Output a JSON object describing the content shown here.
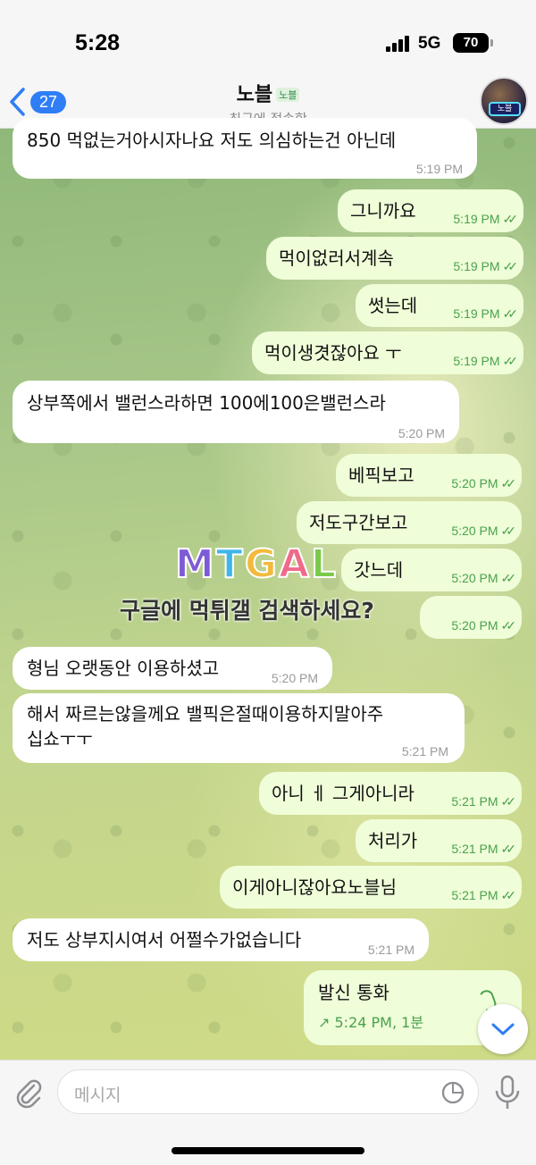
{
  "status_bar": {
    "time": "5:28",
    "network": "5G",
    "battery": "70"
  },
  "header": {
    "back_count": "27",
    "title": "노블",
    "title_badge": "노블",
    "subtitle": "최근에 접속함",
    "avatar_label": "노블"
  },
  "messages": [
    {
      "dir": "in",
      "text": "850 먹없는거아시자나요 저도 의심하는건 아닌데",
      "time": "5:19 PM"
    },
    {
      "dir": "out",
      "text": "그니까요",
      "time": "5:19 PM"
    },
    {
      "dir": "out",
      "text": "먹이없러서계속",
      "time": "5:19 PM"
    },
    {
      "dir": "out",
      "text": "썻는데",
      "time": "5:19 PM"
    },
    {
      "dir": "out",
      "text": "먹이생겻잖아요 ㅜ",
      "time": "5:19 PM"
    },
    {
      "dir": "in",
      "text": "상부쪽에서 밸런스라하면 100에100은밸런스라",
      "time": "5:20 PM"
    },
    {
      "dir": "out",
      "text": "베픽보고",
      "time": "5:20 PM"
    },
    {
      "dir": "out",
      "text": "저도구간보고",
      "time": "5:20 PM"
    },
    {
      "dir": "out",
      "text": "갓느데",
      "time": "5:20 PM"
    },
    {
      "dir": "out",
      "text": "",
      "time": "5:20 PM"
    },
    {
      "dir": "in",
      "text": "형님 오랫동안 이용하셨고",
      "time": "5:20 PM"
    },
    {
      "dir": "in",
      "text_line1": "해서 짜르는않을께요 밸픽은절때이용하지말아주",
      "text_line2": "십쇼ㅜㅜ",
      "time": "5:21 PM"
    },
    {
      "dir": "out",
      "text": "아니 ㅔ 그게아니라",
      "time": "5:21 PM"
    },
    {
      "dir": "out",
      "text": "처리가",
      "time": "5:21 PM"
    },
    {
      "dir": "out",
      "text": "이게아니잖아요노블님",
      "time": "5:21 PM"
    },
    {
      "dir": "in",
      "text": "저도 상부지시여서 어쩔수가없습니다",
      "time": "5:21 PM"
    }
  ],
  "call": {
    "title": "발신 통화",
    "meta": "↗ 5:24 PM, 1분"
  },
  "watermark": {
    "logo": "MTGAL",
    "text": "구글에 먹튀갤 검색하세요?"
  },
  "input": {
    "placeholder": "메시지"
  },
  "icons": {
    "back": "chevron-left-icon",
    "attach": "paperclip-icon",
    "sticker": "sticker-icon",
    "mic": "microphone-icon",
    "scroll": "chevron-down-icon",
    "read": "double-check-icon"
  },
  "colors": {
    "accent": "#2f7ef5",
    "outgoing_bubble": "#effdd8",
    "incoming_bubble": "#ffffff",
    "outgoing_time": "#49a24d"
  }
}
